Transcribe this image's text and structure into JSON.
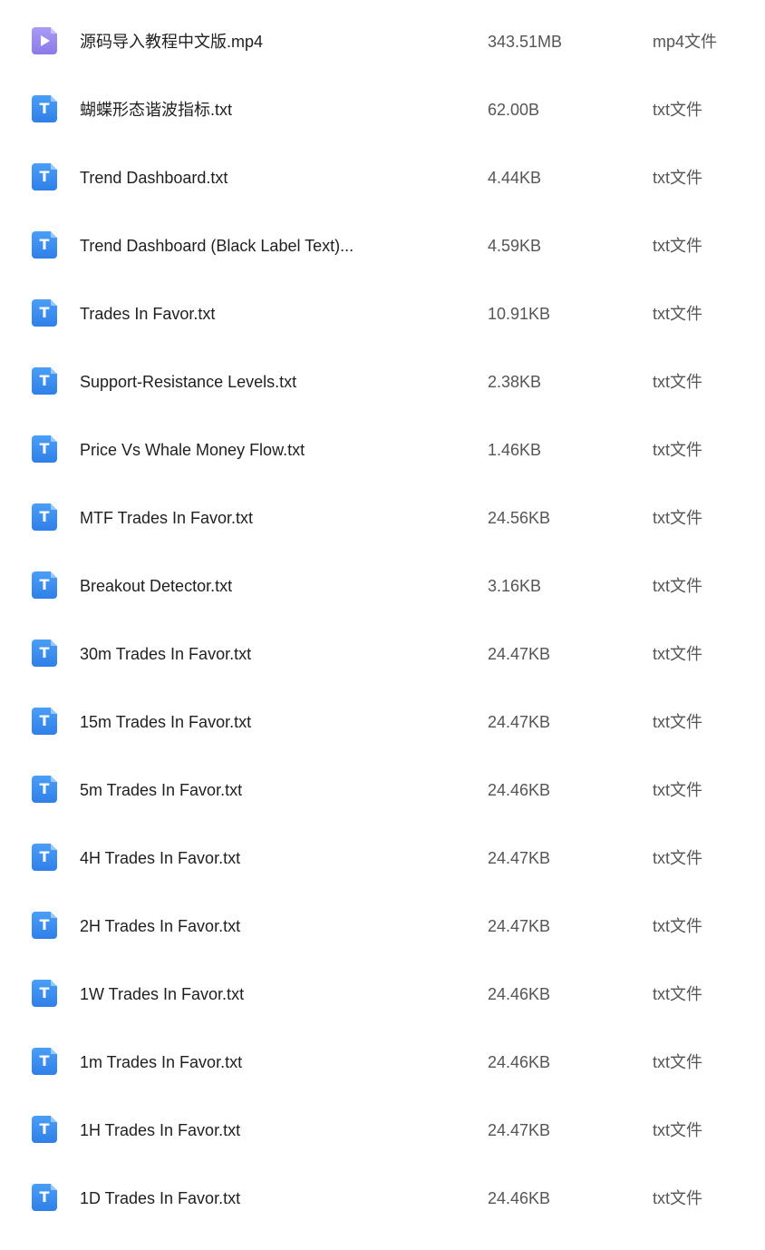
{
  "files": [
    {
      "name": "源码导入教程中文版.mp4",
      "size": "343.51MB",
      "type": "mp4文件",
      "icon": "video-file-icon"
    },
    {
      "name": "蝴蝶形态谐波指标.txt",
      "size": "62.00B",
      "type": "txt文件",
      "icon": "text-file-icon"
    },
    {
      "name": "Trend Dashboard.txt",
      "size": "4.44KB",
      "type": "txt文件",
      "icon": "text-file-icon"
    },
    {
      "name": "Trend Dashboard (Black Label Text)...",
      "size": "4.59KB",
      "type": "txt文件",
      "icon": "text-file-icon"
    },
    {
      "name": "Trades In Favor.txt",
      "size": "10.91KB",
      "type": "txt文件",
      "icon": "text-file-icon"
    },
    {
      "name": "Support-Resistance Levels.txt",
      "size": "2.38KB",
      "type": "txt文件",
      "icon": "text-file-icon"
    },
    {
      "name": "Price Vs Whale Money Flow.txt",
      "size": "1.46KB",
      "type": "txt文件",
      "icon": "text-file-icon"
    },
    {
      "name": "MTF Trades In Favor.txt",
      "size": "24.56KB",
      "type": "txt文件",
      "icon": "text-file-icon"
    },
    {
      "name": "Breakout Detector.txt",
      "size": "3.16KB",
      "type": "txt文件",
      "icon": "text-file-icon"
    },
    {
      "name": "30m Trades In Favor.txt",
      "size": "24.47KB",
      "type": "txt文件",
      "icon": "text-file-icon"
    },
    {
      "name": "15m Trades In Favor.txt",
      "size": "24.47KB",
      "type": "txt文件",
      "icon": "text-file-icon"
    },
    {
      "name": "5m Trades In Favor.txt",
      "size": "24.46KB",
      "type": "txt文件",
      "icon": "text-file-icon"
    },
    {
      "name": "4H Trades In Favor.txt",
      "size": "24.47KB",
      "type": "txt文件",
      "icon": "text-file-icon"
    },
    {
      "name": "2H Trades In Favor.txt",
      "size": "24.47KB",
      "type": "txt文件",
      "icon": "text-file-icon"
    },
    {
      "name": "1W Trades In Favor.txt",
      "size": "24.46KB",
      "type": "txt文件",
      "icon": "text-file-icon"
    },
    {
      "name": "1m Trades In Favor.txt",
      "size": "24.46KB",
      "type": "txt文件",
      "icon": "text-file-icon"
    },
    {
      "name": "1H Trades In Favor.txt",
      "size": "24.47KB",
      "type": "txt文件",
      "icon": "text-file-icon"
    },
    {
      "name": "1D Trades In Favor.txt",
      "size": "24.46KB",
      "type": "txt文件",
      "icon": "text-file-icon"
    }
  ],
  "colors": {
    "text_icon": "#3a8ef3",
    "video_icon": "#9b8cf2",
    "name_text": "#1f1f1f",
    "meta_text": "#555555"
  }
}
